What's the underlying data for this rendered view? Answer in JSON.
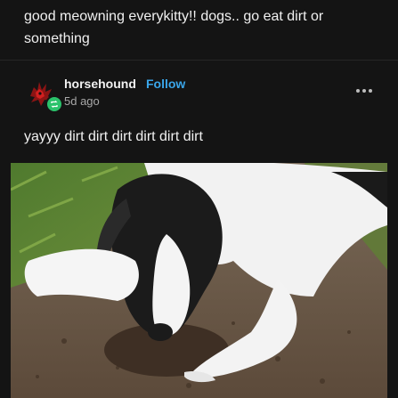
{
  "post": {
    "text": "good meowning everykitty!! dogs.. go eat dirt or something"
  },
  "reblog": {
    "username": "horsehound",
    "follow_label": "Follow",
    "timestamp": "5d ago",
    "text": "yayyy dirt dirt dirt dirt dirt dirt",
    "avatar_icon": "red-creature-avatar",
    "badge_icon": "reblog-icon",
    "more_icon": "more-dots-icon"
  },
  "image": {
    "subject": "dog-digging-dirt-photo"
  },
  "colors": {
    "background": "#141414",
    "text": "#f0f0f0",
    "follow": "#3aa6ea",
    "muted": "#a8a8a8",
    "badge": "#2bc26b"
  }
}
